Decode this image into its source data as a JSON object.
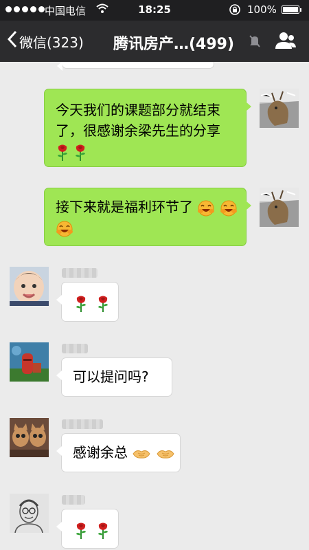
{
  "status_bar": {
    "carrier": "中国电信",
    "time": "18:25",
    "battery": "100%",
    "battery_level": 1.0
  },
  "nav": {
    "back_label": "微信(323)",
    "title": "腾讯房产…(499)"
  },
  "messages": [
    {
      "side": "right",
      "text": "今天我们的课题部分就结束了，很感谢余梁先生的分享",
      "emoji": [
        "rose-emoji",
        "rose-emoji"
      ]
    },
    {
      "side": "right",
      "text": "接下来就是福利环节了",
      "emoji": [
        "laughing-emoji",
        "laughing-emoji",
        "laughing-emoji"
      ]
    },
    {
      "side": "left",
      "text": "",
      "emoji": [
        "rose-emoji",
        "rose-emoji"
      ]
    },
    {
      "side": "left",
      "text": "可以提问吗?",
      "emoji": []
    },
    {
      "side": "left",
      "text": "感谢余总",
      "emoji": [
        "handshake-emoji",
        "handshake-emoji"
      ]
    },
    {
      "side": "left",
      "text": "",
      "emoji": [
        "rose-emoji",
        "rose-emoji"
      ]
    }
  ],
  "colors": {
    "sent_bubble": "#9fe654",
    "received_bubble": "#ffffff",
    "nav_bg": "#2c2c2e",
    "chat_bg": "#ebebeb"
  }
}
